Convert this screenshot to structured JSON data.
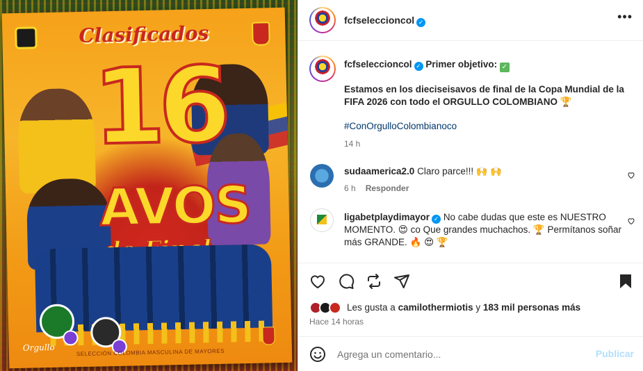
{
  "post": {
    "username": "fcfseleccioncol",
    "verified_icon": "verified-badge-icon",
    "more_icon": "more-options-icon"
  },
  "poster": {
    "title": "Clasificados",
    "number": "16",
    "avos": "AVOS",
    "final": "de Final",
    "footer": "SELECCIÓN COLOMBIA MASCULINA DE MAYORES",
    "signature": "Orgullo"
  },
  "caption": {
    "username": "fcfseleccioncol",
    "lead": "Primer objetivo:",
    "check": "✓",
    "body": "Estamos en los dieciseisavos de final de la Copa Mundial de la FIFA 2026 con todo el ORGULLO COLOMBIANO 🏆",
    "hashtag": "#ConOrgulloColombianoco",
    "time": "14 h"
  },
  "comments": [
    {
      "username": "sudaamerica2.0",
      "text": "Claro parce!!! 🙌 🙌",
      "time": "6 h",
      "reply": "Responder"
    },
    {
      "username": "ligabetplaydimayor",
      "text": "No cabe dudas que este es NUESTRO MOMENTO. 😍 co Que grandes muchachos. 🏆 Permítanos soñar más GRANDE. 🔥 😍 🏆"
    }
  ],
  "likes": {
    "prefix": "Les gusta a ",
    "user": "camilothermiotis",
    "middle": " y ",
    "count": "183 mil personas más"
  },
  "posted_ago": "Hace 14 horas",
  "comment_box": {
    "placeholder": "Agrega un comentario...",
    "publish": "Publicar"
  },
  "colors": {
    "accent": "#0095f6",
    "publish_disabled": "#b2dffc",
    "muted": "#737373",
    "hashtag": "#00376b"
  }
}
